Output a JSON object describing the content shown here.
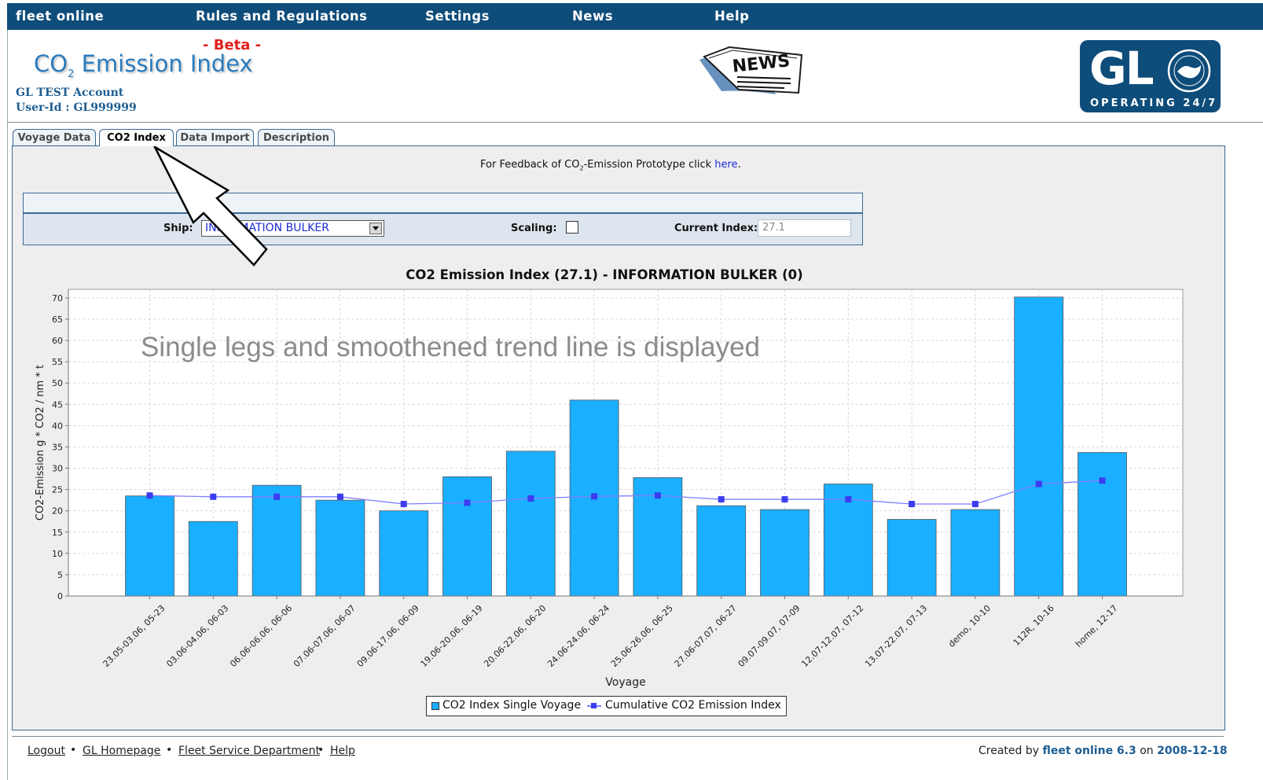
{
  "nav": {
    "items": [
      "fleet online",
      "Rules and Regulations",
      "Settings",
      "News",
      "Help"
    ]
  },
  "header": {
    "beta": "- Beta -",
    "title_prefix": "CO",
    "title_sub": "2",
    "title_suffix": " Emission Index",
    "account": "GL TEST Account",
    "user_id": "User-Id : GL999999",
    "news_logo": "NEWS",
    "gl_logo": "GL",
    "gl_tagline": "OPERATING 24/7"
  },
  "tabs": [
    {
      "label": "Voyage Data"
    },
    {
      "label": "CO2 Index"
    },
    {
      "label": "Data Import"
    },
    {
      "label": "Description"
    }
  ],
  "feedback": {
    "prefix": "For Feedback of CO",
    "sub": "2",
    "suffix": "-Emission Prototype click ",
    "link": "here",
    "end": "."
  },
  "form": {
    "ship_label": "Ship:",
    "ship_value": "INFORMATION BULKER",
    "scaling_label": "Scaling:",
    "scaling_checked": false,
    "index_label": "Current Index:",
    "index_value": "27.1"
  },
  "annotation": "Single legs and smoothened trend line is displayed",
  "chart_data": {
    "type": "bar",
    "title": "CO2 Emission Index (27.1) - INFORMATION BULKER (0)",
    "xlabel": "Voyage",
    "ylabel": "CO2-Emission  g * CO2 / nm * t",
    "ylim": [
      0,
      72
    ],
    "yticks": [
      0,
      5,
      10,
      15,
      20,
      25,
      30,
      35,
      40,
      45,
      50,
      55,
      60,
      65,
      70
    ],
    "grid": true,
    "legend_position": "bottom",
    "categories": [
      "23.05-03.06, 05-23",
      "03.06-04.06, 06-03",
      "06.06-06.06, 06-06",
      "07.06-07.06, 06-07",
      "09.06-17.06, 06-09",
      "19.06-20.06, 06-19",
      "20.06-22.06, 06-20",
      "24.06-24.06, 06-24",
      "25.06-26.06, 06-25",
      "27.06-07.07, 06-27",
      "09.07-09.07, 07-09",
      "12.07-12.07, 07-12",
      "13.07-22.07, 07-13",
      "demo, 10-10",
      "112R, 10-16",
      "home, 12-17"
    ],
    "series": [
      {
        "name": "CO2 Index Single Voyage",
        "type": "bar",
        "color": "#1aafff",
        "values": [
          23.5,
          17.5,
          26.0,
          22.5,
          20.0,
          28.0,
          34.0,
          46.0,
          27.8,
          21.2,
          20.3,
          26.3,
          18.0,
          20.3,
          70.2,
          33.7
        ]
      },
      {
        "name": "Cumulative CO2 Emission Index",
        "type": "line",
        "color": "#7f7fff",
        "values": [
          23.6,
          23.3,
          23.3,
          23.3,
          21.6,
          21.9,
          22.9,
          23.4,
          23.6,
          22.7,
          22.7,
          22.7,
          21.6,
          21.6,
          26.3,
          27.1
        ]
      }
    ]
  },
  "footer": {
    "links": [
      "Logout",
      "GL Homepage",
      "Fleet Service Department",
      "Help"
    ],
    "credit_prefix": "Created by ",
    "credit_app": "fleet online 6.3",
    "credit_mid": " on ",
    "credit_date": "2008-12-18"
  },
  "icons": {
    "pointer": "arrow-pointer-icon",
    "dropdown": "chevron-down-icon",
    "news": "newspaper-icon",
    "globe": "globe-icon"
  }
}
